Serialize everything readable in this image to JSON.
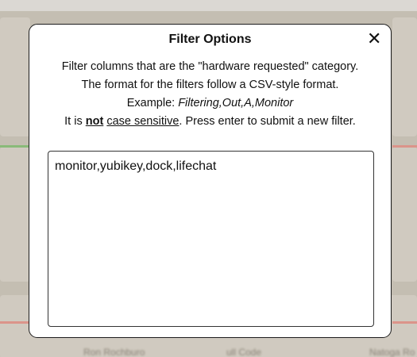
{
  "modal": {
    "title": "Filter Options",
    "close_icon": "close-icon",
    "description": {
      "line1": "Filter columns that are the \"hardware requested\" category.",
      "line2": "The format for the filters follow a CSV-style format.",
      "example_prefix": "Example: ",
      "example_value": "Filtering,Out,A,Monitor",
      "line4_prefix": "It is ",
      "line4_emphasis": "not",
      "line4_middle": " ",
      "line4_underlined": "case sensitive",
      "line4_suffix": ". Press enter to submit a new filter."
    },
    "filter_input": {
      "value": "monitor,yubikey,dock,lifechat"
    }
  },
  "background": {
    "row_texts": [
      "Ron Rochburo",
      "ull Code",
      "Natoga Ro"
    ]
  },
  "colors": {
    "accent_green": "#7bbf6a",
    "accent_red": "#e07a6e"
  }
}
